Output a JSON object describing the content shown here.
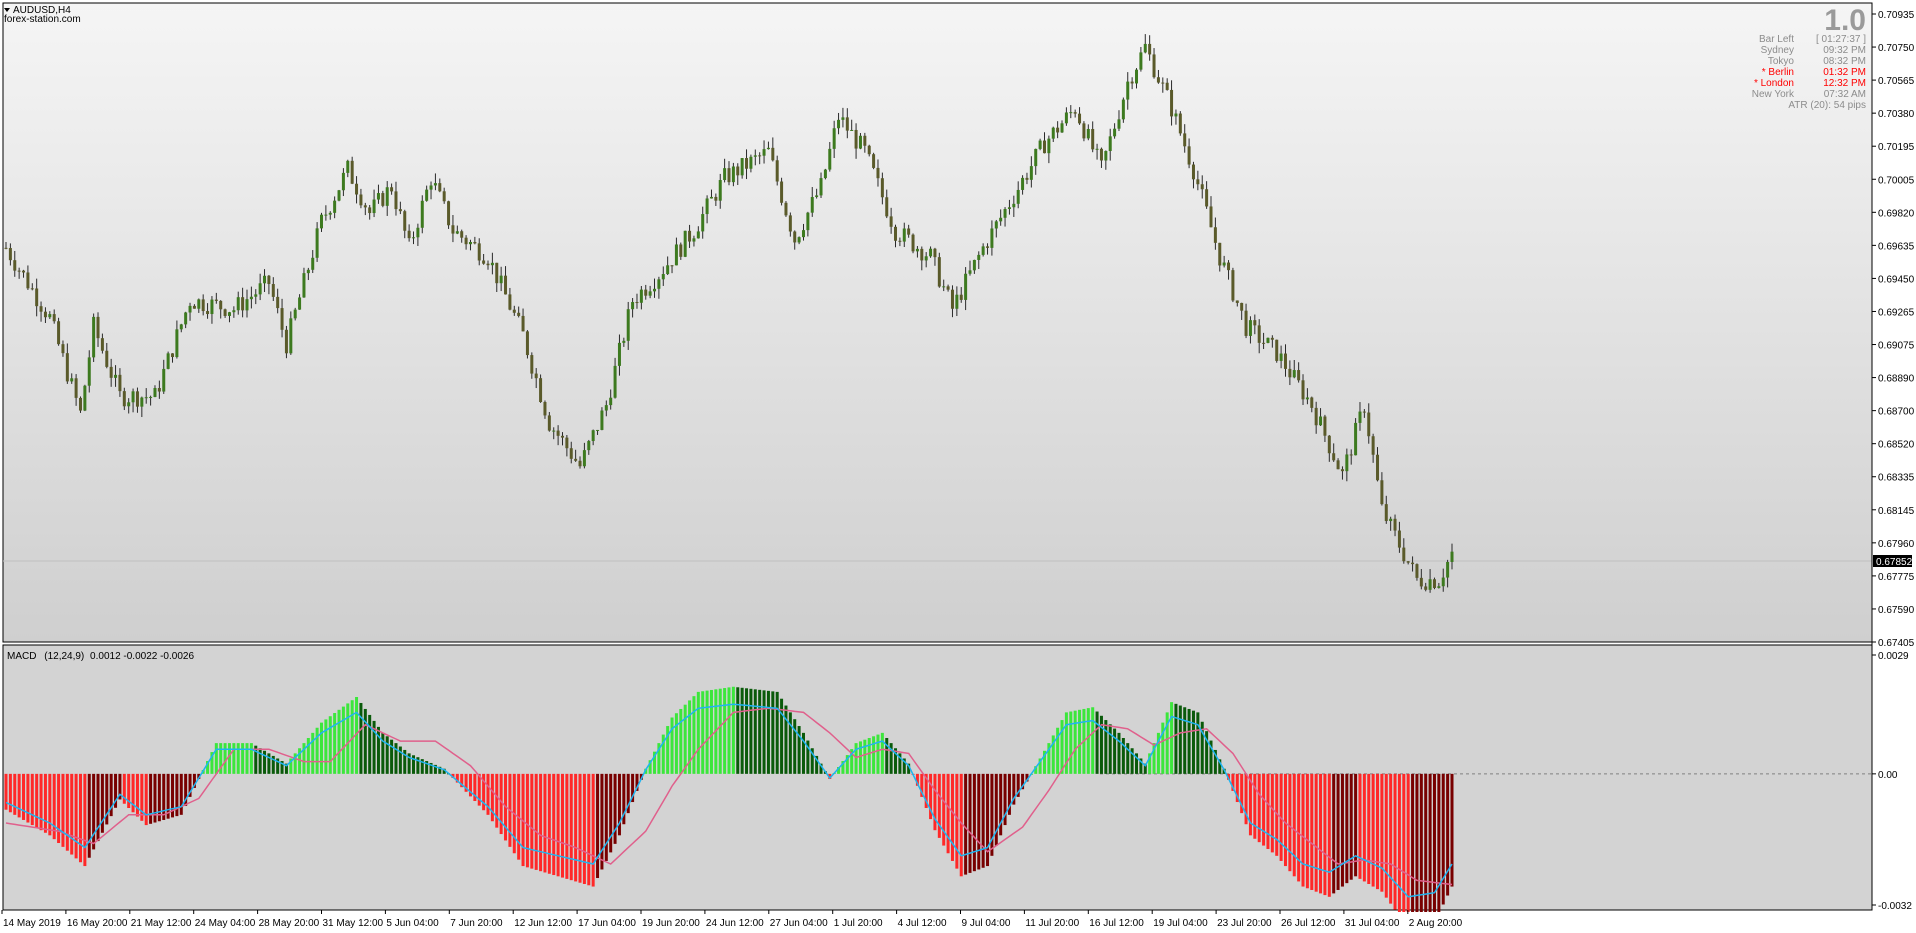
{
  "window": {
    "symbol_title": "AUDUSD,H4",
    "watermark": "forex-station.com"
  },
  "info_panel": {
    "big_value": "1.0",
    "rows": [
      {
        "label": "Bar Left",
        "value": "[ 01:27:37 ]",
        "highlight": false
      },
      {
        "label": "Sydney",
        "value": "09:32 PM",
        "highlight": false
      },
      {
        "label": "Tokyo",
        "value": "08:32 PM",
        "highlight": false
      },
      {
        "label": "* Berlin",
        "value": "01:32 PM",
        "highlight": true
      },
      {
        "label": "* London",
        "value": "12:32 PM",
        "highlight": true
      },
      {
        "label": "New York",
        "value": "07:32 AM",
        "highlight": false
      }
    ],
    "atr_text": "ATR (20): 54 pips",
    "text_color": "#8c8c8c",
    "highlight_color": "#ff0000"
  },
  "colors": {
    "price_bg_top": "#f5f5f5",
    "price_bg_bottom": "#cfcfcf",
    "macd_bg": "#d3d3d3",
    "candle_up": "#3d7a1f",
    "candle_down": "#5a5a2a",
    "bid_line": "#c0c0c0",
    "macd_line": "#1eb4f0",
    "signal_line": "#e0608c",
    "hist_up_bright": "#3ce63c",
    "hist_up_dark": "#0a5a0a",
    "hist_down_bright": "#ff2828",
    "hist_down_dark": "#780000"
  },
  "price_axis": {
    "ticks": [
      "0.70935",
      "0.70750",
      "0.70565",
      "0.70380",
      "0.70195",
      "0.70005",
      "0.69820",
      "0.69635",
      "0.69450",
      "0.69265",
      "0.69075",
      "0.68890",
      "0.68700",
      "0.68520",
      "0.68335",
      "0.68145",
      "0.67960",
      "0.67775",
      "0.67590",
      "0.67405"
    ],
    "current_price": "0.67852"
  },
  "macd_panel": {
    "label": "MACD",
    "params": "(12,24,9)",
    "values": "0.0012 -0.0022 -0.0026",
    "axis_labels": [
      "0.0029",
      "0.00",
      "-0.0032"
    ]
  },
  "time_axis": {
    "labels": [
      "14 May 2019",
      "16 May 20:00",
      "21 May 12:00",
      "24 May 04:00",
      "28 May 20:00",
      "31 May 12:00",
      "5 Jun 04:00",
      "7 Jun 20:00",
      "12 Jun 12:00",
      "17 Jun 04:00",
      "19 Jun 20:00",
      "24 Jun 12:00",
      "27 Jun 04:00",
      "1 Jul 20:00",
      "4 Jul 12:00",
      "9 Jul 04:00",
      "11 Jul 20:00",
      "16 Jul 12:00",
      "19 Jul 04:00",
      "23 Jul 20:00",
      "26 Jul 12:00",
      "31 Jul 04:00",
      "2 Aug 20:00"
    ]
  },
  "chart_data": {
    "type": "candlestick",
    "symbol": "AUDUSD",
    "timeframe": "H4",
    "price_range": [
      0.67405,
      0.71
    ],
    "price_waypoints": [
      [
        0,
        0.6965
      ],
      [
        10,
        0.6925
      ],
      [
        17,
        0.687
      ],
      [
        20,
        0.692
      ],
      [
        26,
        0.688
      ],
      [
        34,
        0.688
      ],
      [
        42,
        0.6935
      ],
      [
        52,
        0.693
      ],
      [
        60,
        0.6945
      ],
      [
        64,
        0.691
      ],
      [
        72,
        0.698
      ],
      [
        78,
        0.701
      ],
      [
        83,
        0.6985
      ],
      [
        88,
        0.7
      ],
      [
        92,
        0.6965
      ],
      [
        97,
        0.7005
      ],
      [
        102,
        0.6975
      ],
      [
        110,
        0.696
      ],
      [
        118,
        0.6915
      ],
      [
        124,
        0.6865
      ],
      [
        131,
        0.684
      ],
      [
        137,
        0.6875
      ],
      [
        143,
        0.6935
      ],
      [
        149,
        0.695
      ],
      [
        157,
        0.6975
      ],
      [
        164,
        0.7005
      ],
      [
        174,
        0.702
      ],
      [
        180,
        0.697
      ],
      [
        186,
        0.7
      ],
      [
        190,
        0.704
      ],
      [
        196,
        0.702
      ],
      [
        203,
        0.6975
      ],
      [
        211,
        0.696
      ],
      [
        216,
        0.693
      ],
      [
        223,
        0.6965
      ],
      [
        230,
        0.6995
      ],
      [
        237,
        0.7025
      ],
      [
        244,
        0.7045
      ],
      [
        250,
        0.701
      ],
      [
        256,
        0.706
      ],
      [
        260,
        0.708
      ],
      [
        266,
        0.7045
      ],
      [
        271,
        0.701
      ],
      [
        277,
        0.696
      ],
      [
        283,
        0.692
      ],
      [
        290,
        0.6905
      ],
      [
        298,
        0.6875
      ],
      [
        305,
        0.6835
      ],
      [
        310,
        0.6875
      ],
      [
        314,
        0.6815
      ],
      [
        318,
        0.6795
      ],
      [
        322,
        0.6775
      ],
      [
        327,
        0.6775
      ],
      [
        330,
        0.679
      ]
    ],
    "macd": {
      "params": [
        12,
        24,
        9
      ],
      "current": {
        "main": 0.0012,
        "signal": -0.0022,
        "histogram": -0.0026
      },
      "range": [
        -0.0032,
        0.0029
      ],
      "macd_waypoints": [
        [
          0,
          -0.0007
        ],
        [
          10,
          -0.0012
        ],
        [
          18,
          -0.0018
        ],
        [
          26,
          -0.0005
        ],
        [
          32,
          -0.001
        ],
        [
          40,
          -0.0008
        ],
        [
          48,
          0.0006
        ],
        [
          56,
          0.0006
        ],
        [
          64,
          0.0002
        ],
        [
          72,
          0.001
        ],
        [
          80,
          0.0015
        ],
        [
          86,
          0.0008
        ],
        [
          92,
          0.0004
        ],
        [
          100,
          0.0001
        ],
        [
          110,
          -0.0008
        ],
        [
          118,
          -0.0018
        ],
        [
          126,
          -0.002
        ],
        [
          134,
          -0.0022
        ],
        [
          140,
          -0.0012
        ],
        [
          146,
          0.0001
        ],
        [
          152,
          0.0011
        ],
        [
          158,
          0.0016
        ],
        [
          166,
          0.0017
        ],
        [
          176,
          0.0016
        ],
        [
          182,
          0.0008
        ],
        [
          188,
          -0.0001
        ],
        [
          194,
          0.0006
        ],
        [
          200,
          0.0008
        ],
        [
          206,
          0.0002
        ],
        [
          212,
          -0.0011
        ],
        [
          218,
          -0.002
        ],
        [
          224,
          -0.0018
        ],
        [
          230,
          -0.0006
        ],
        [
          236,
          0.0003
        ],
        [
          242,
          0.0012
        ],
        [
          248,
          0.0013
        ],
        [
          254,
          0.0008
        ],
        [
          260,
          0.0002
        ],
        [
          266,
          0.0014
        ],
        [
          272,
          0.0012
        ],
        [
          278,
          0.0001
        ],
        [
          284,
          -0.0012
        ],
        [
          290,
          -0.0016
        ],
        [
          296,
          -0.0022
        ],
        [
          302,
          -0.0024
        ],
        [
          308,
          -0.002
        ],
        [
          314,
          -0.0023
        ],
        [
          320,
          -0.003
        ],
        [
          326,
          -0.0029
        ],
        [
          330,
          -0.0022
        ]
      ],
      "signal_waypoints": [
        [
          0,
          -0.0012
        ],
        [
          12,
          -0.0014
        ],
        [
          20,
          -0.0017
        ],
        [
          28,
          -0.001
        ],
        [
          36,
          -0.001
        ],
        [
          44,
          -0.0006
        ],
        [
          52,
          0.0006
        ],
        [
          60,
          0.0006
        ],
        [
          68,
          0.0003
        ],
        [
          74,
          0.0003
        ],
        [
          82,
          0.0012
        ],
        [
          90,
          0.0008
        ],
        [
          98,
          0.0008
        ],
        [
          106,
          0.0002
        ],
        [
          114,
          -0.0008
        ],
        [
          122,
          -0.0015
        ],
        [
          130,
          -0.0018
        ],
        [
          138,
          -0.0022
        ],
        [
          146,
          -0.0014
        ],
        [
          152,
          -0.0003
        ],
        [
          158,
          0.0006
        ],
        [
          166,
          0.0015
        ],
        [
          174,
          0.0016
        ],
        [
          182,
          0.0015
        ],
        [
          188,
          0.001
        ],
        [
          194,
          0.0004
        ],
        [
          200,
          0.0006
        ],
        [
          206,
          0.0005
        ],
        [
          212,
          -0.0004
        ],
        [
          218,
          -0.0012
        ],
        [
          224,
          -0.0019
        ],
        [
          232,
          -0.0013
        ],
        [
          238,
          -0.0004
        ],
        [
          244,
          0.0006
        ],
        [
          250,
          0.0012
        ],
        [
          256,
          0.0011
        ],
        [
          262,
          0.0007
        ],
        [
          268,
          0.001
        ],
        [
          274,
          0.0011
        ],
        [
          280,
          0.0005
        ],
        [
          286,
          -0.0005
        ],
        [
          292,
          -0.0012
        ],
        [
          298,
          -0.0017
        ],
        [
          304,
          -0.0022
        ],
        [
          310,
          -0.0021
        ],
        [
          316,
          -0.0022
        ],
        [
          322,
          -0.0026
        ],
        [
          330,
          -0.0027
        ]
      ]
    }
  }
}
